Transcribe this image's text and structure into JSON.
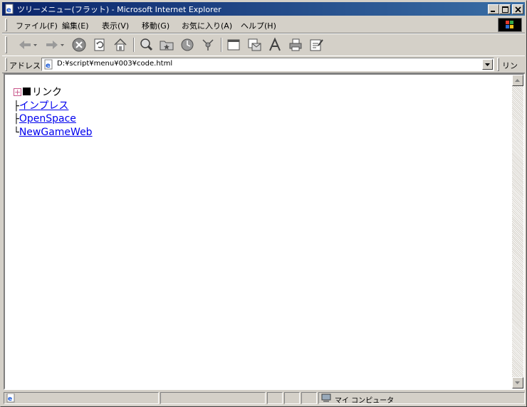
{
  "window": {
    "title": "ツリーメニュー(フラット) - Microsoft Internet Explorer",
    "minimize_label": "_",
    "close_label": "×"
  },
  "menubar": {
    "items": [
      {
        "label": "ファイル(F)"
      },
      {
        "label": "編集(E)"
      },
      {
        "label": "表示(V)"
      },
      {
        "label": "移動(G)"
      },
      {
        "label": "お気に入り(A)"
      },
      {
        "label": "ヘルプ(H)"
      }
    ]
  },
  "toolbar": {
    "buttons": [
      {
        "icon": "back-arrow-icon"
      },
      {
        "icon": "forward-arrow-icon"
      },
      {
        "icon": "stop-icon"
      },
      {
        "icon": "refresh-icon"
      },
      {
        "icon": "home-icon"
      },
      {
        "icon": "search-icon"
      },
      {
        "icon": "favorites-icon"
      },
      {
        "icon": "history-icon"
      },
      {
        "icon": "channels-icon"
      },
      {
        "icon": "fullscreen-icon"
      },
      {
        "icon": "mail-icon"
      },
      {
        "icon": "font-icon"
      },
      {
        "icon": "print-icon"
      },
      {
        "icon": "edit-icon"
      }
    ]
  },
  "addressbar": {
    "label": "アドレス",
    "value": "D:¥script¥menu¥003¥code.html",
    "links_label": "リンク"
  },
  "tree": {
    "expander_symbol": "+",
    "root_label": "リンク",
    "items": [
      {
        "prefix": "├",
        "label": "インプレス"
      },
      {
        "prefix": "├",
        "label": "OpenSpace"
      },
      {
        "prefix": "└",
        "label": "NewGameWeb"
      }
    ]
  },
  "statusbar": {
    "zone_label": "マイ コンピュータ"
  },
  "colors": {
    "titlebar_start": "#0a246a",
    "titlebar_end": "#3a6ea5",
    "chrome": "#d4d0c8",
    "link": "#0000ee",
    "expander": "#c8558a"
  }
}
